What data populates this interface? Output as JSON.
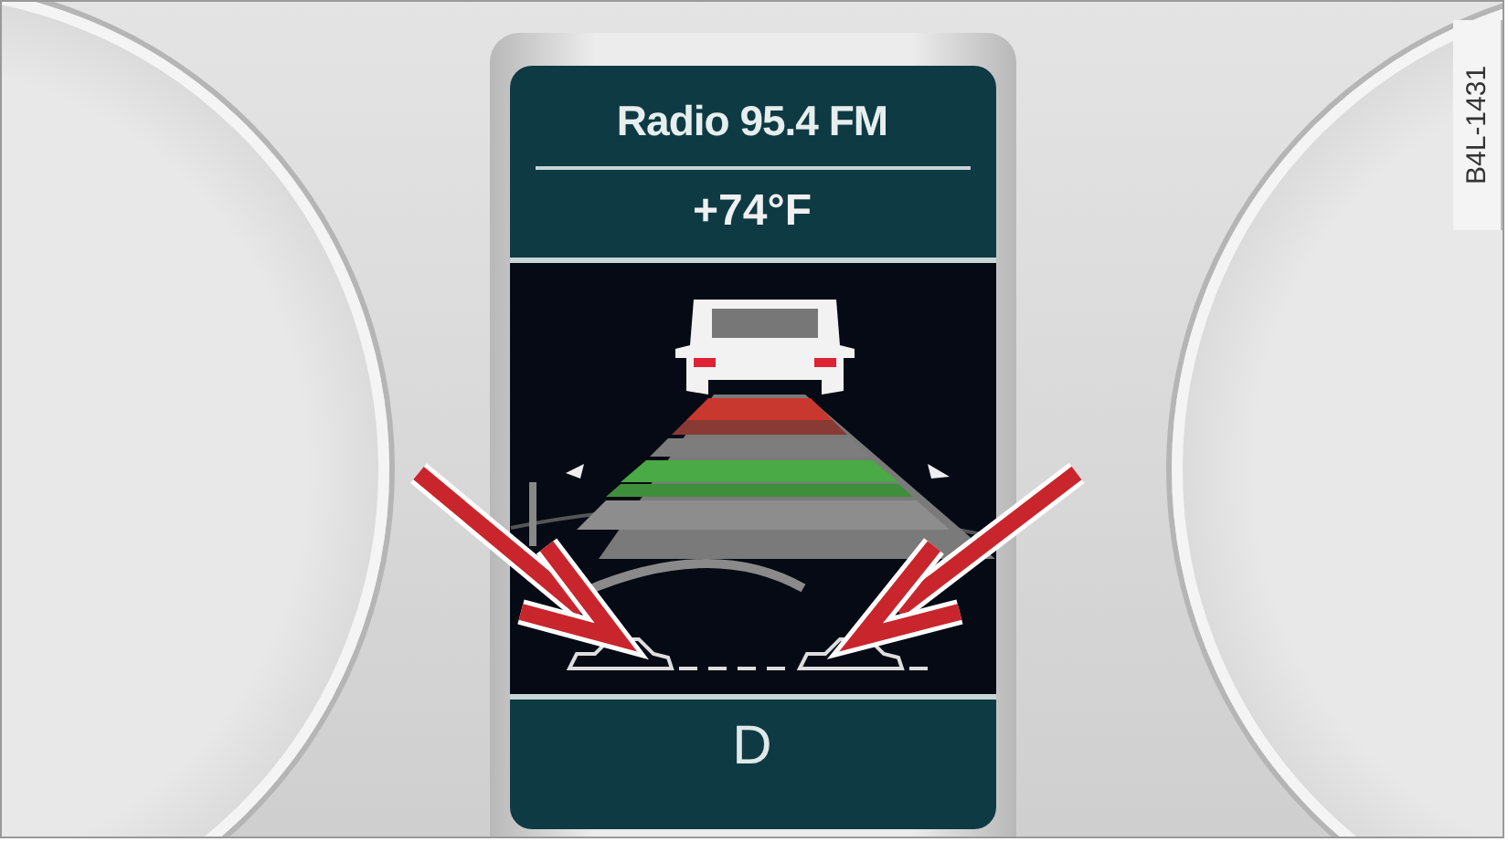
{
  "display": {
    "header": "Radio 95.4 FM",
    "temperature": "+74°F",
    "gear": "D"
  },
  "figure_code": "B4L-1431"
}
